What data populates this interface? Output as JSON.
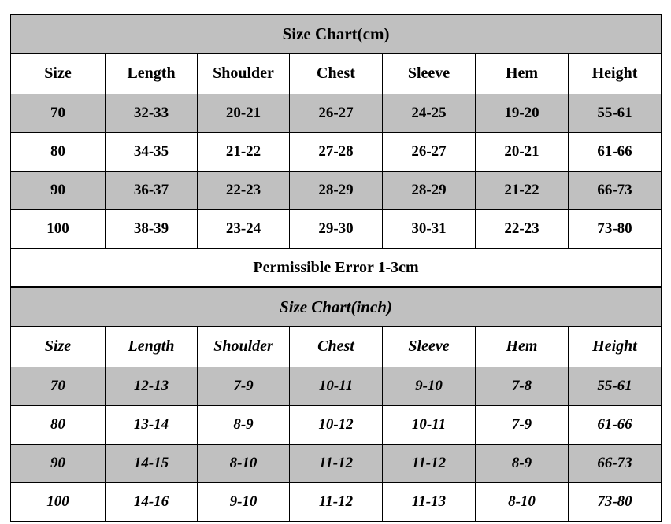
{
  "cm_chart": {
    "title": "Size Chart(cm)",
    "columns": [
      "Size",
      "Length",
      "Shoulder",
      "Chest",
      "Sleeve",
      "Hem",
      "Height"
    ],
    "rows": [
      [
        "70",
        "32-33",
        "20-21",
        "26-27",
        "24-25",
        "19-20",
        "55-61"
      ],
      [
        "80",
        "34-35",
        "21-22",
        "27-28",
        "26-27",
        "20-21",
        "61-66"
      ],
      [
        "90",
        "36-37",
        "22-23",
        "28-29",
        "28-29",
        "21-22",
        "66-73"
      ],
      [
        "100",
        "38-39",
        "23-24",
        "29-30",
        "30-31",
        "22-23",
        "73-80"
      ]
    ]
  },
  "note": {
    "text": "Permissible Error 1-3cm",
    "color": "#ff0000"
  },
  "inch_chart": {
    "title": "Size Chart(inch)",
    "columns": [
      "Size",
      "Length",
      "Shoulder",
      "Chest",
      "Sleeve",
      "Hem",
      "Height"
    ],
    "rows": [
      [
        "70",
        "12-13",
        "7-9",
        "10-11",
        "9-10",
        "7-8",
        "55-61"
      ],
      [
        "80",
        "13-14",
        "8-9",
        "10-12",
        "10-11",
        "7-9",
        "61-66"
      ],
      [
        "90",
        "14-15",
        "8-10",
        "11-12",
        "11-12",
        "8-9",
        "66-73"
      ],
      [
        "100",
        "14-16",
        "9-10",
        "11-12",
        "11-13",
        "8-10",
        "73-80"
      ]
    ]
  },
  "style": {
    "shaded_row_color": "#c0c0c0",
    "plain_row_color": "#ffffff",
    "border_color": "#000000"
  },
  "chart_data": {
    "type": "table",
    "title": "Size Chart(cm) / Size Chart(inch)",
    "tables": [
      {
        "name": "Size Chart(cm)",
        "unit": "cm",
        "columns": [
          "Size",
          "Length",
          "Shoulder",
          "Chest",
          "Sleeve",
          "Hem",
          "Height"
        ],
        "rows": [
          [
            "70",
            "32-33",
            "20-21",
            "26-27",
            "24-25",
            "19-20",
            "55-61"
          ],
          [
            "80",
            "34-35",
            "21-22",
            "27-28",
            "26-27",
            "20-21",
            "61-66"
          ],
          [
            "90",
            "36-37",
            "22-23",
            "28-29",
            "28-29",
            "21-22",
            "66-73"
          ],
          [
            "100",
            "38-39",
            "23-24",
            "29-30",
            "30-31",
            "22-23",
            "73-80"
          ]
        ]
      },
      {
        "name": "Size Chart(inch)",
        "unit": "inch",
        "columns": [
          "Size",
          "Length",
          "Shoulder",
          "Chest",
          "Sleeve",
          "Hem",
          "Height"
        ],
        "rows": [
          [
            "70",
            "12-13",
            "7-9",
            "10-11",
            "9-10",
            "7-8",
            "55-61"
          ],
          [
            "80",
            "13-14",
            "8-9",
            "10-12",
            "10-11",
            "7-9",
            "61-66"
          ],
          [
            "90",
            "14-15",
            "8-10",
            "11-12",
            "11-12",
            "8-9",
            "66-73"
          ],
          [
            "100",
            "14-16",
            "9-10",
            "11-12",
            "11-13",
            "8-10",
            "73-80"
          ]
        ]
      }
    ],
    "annotations": [
      "Permissible Error 1-3cm"
    ]
  }
}
